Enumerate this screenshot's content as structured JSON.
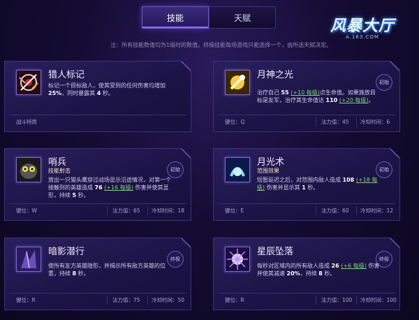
{
  "tabs": [
    {
      "label": "技能",
      "active": true
    },
    {
      "label": "天赋",
      "active": false
    }
  ],
  "logo": {
    "title": "风暴大厅",
    "subtitle": "A.163.COM"
  },
  "notice": "注：所有技能数值均为1级时的数值。终极技能每场游戏只能选择一个，由所选天赋决定。",
  "skills": [
    {
      "name": "猎人标记",
      "icon": "hunter-mark-icon",
      "desc_plain": "标记一个目标敌人，使其受到的任何伤害均增加",
      "desc_value": "25%",
      "desc_rest": "，同时暴露其",
      "desc_value2": "4",
      "desc_end": "秒。",
      "trait_label": "战斗特质"
    },
    {
      "name": "月神之光",
      "icon": "lunar-light-icon",
      "badge": "初始",
      "desc_a": "治疗自己",
      "desc_v1": "55",
      "desc_s1": "(+10 每级)",
      "desc_b": "点生命值。如果施放目标是友军，治疗其生命值达",
      "desc_v2": "110",
      "desc_s2": "(+20 每级)",
      "desc_c": "。",
      "key_label": "键位：Q",
      "mana_label": "法力值：45",
      "cd_label": "冷却时间：6"
    },
    {
      "name": "哨兵",
      "subtitle": "技能射击",
      "icon": "sentinel-icon",
      "badge": "初始",
      "desc_a": "放出一只猫头鹰穿过战场显示沿途情况，对第一个接触到的英雄造成",
      "desc_v1": "76",
      "desc_s1": "(+16 每级)",
      "desc_b": "伤害并使其显形，持续",
      "desc_v2": "5",
      "desc_c": "秒。",
      "key_label": "键位：W",
      "mana_label": "法力值：65",
      "cd_label": "冷却时间：18"
    },
    {
      "name": "月光术",
      "subtitle": "范围效果",
      "icon": "moonfire-icon",
      "badge": "初始",
      "desc_a": "短暂延迟之后，对范围内敌人造成",
      "desc_v1": "108",
      "desc_s1": "(+18 每级)",
      "desc_b": "伤害并显示其",
      "desc_v2": "1",
      "desc_c": "秒。",
      "key_label": "键位：E",
      "mana_label": "法力值：60",
      "cd_label": "冷却时间：12"
    },
    {
      "name": "暗影潜行",
      "icon": "shadowstalk-icon",
      "badge": "终极",
      "desc_a": "使所有友方英雄隐形，并揭示所有敌方英雄的位置，持续",
      "desc_v1": "8",
      "desc_c": "秒。",
      "key_label": "键位：R",
      "mana_label": "法力值：75",
      "cd_label": "冷却时间：50"
    },
    {
      "name": "星辰坠落",
      "icon": "starfall-icon",
      "badge": "终极",
      "desc_a": "每秒对区域内的所有敌人造成",
      "desc_v1": "26",
      "desc_s1": "(+6 每级)",
      "desc_b": "伤害并使其减速",
      "desc_v2": "20%",
      "desc_c": "，持续",
      "desc_v3": "8",
      "desc_d": "秒。",
      "key_label": "键位：R",
      "mana_label": "法力值：100",
      "cd_label": "冷却时间：100"
    }
  ]
}
